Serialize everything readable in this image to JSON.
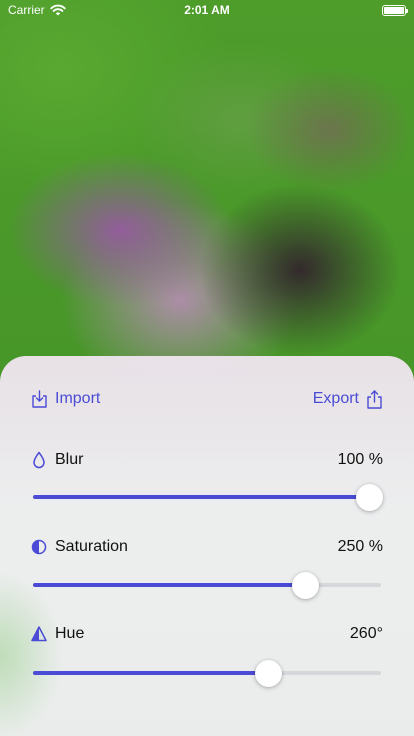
{
  "status_bar": {
    "carrier": "Carrier",
    "time": "2:01 AM"
  },
  "actions": {
    "import_label": "Import",
    "export_label": "Export",
    "accent_color": "#4b4bd6"
  },
  "adjustments": [
    {
      "id": "blur",
      "label": "Blur",
      "value_text": "100 %",
      "fraction": 1.0,
      "icon": "drop-icon"
    },
    {
      "id": "saturation",
      "label": "Saturation",
      "value_text": "250 %",
      "fraction": 0.81,
      "icon": "half-circle-icon"
    },
    {
      "id": "hue",
      "label": "Hue",
      "value_text": "260°",
      "fraction": 0.7,
      "icon": "triangle-icon"
    }
  ]
}
